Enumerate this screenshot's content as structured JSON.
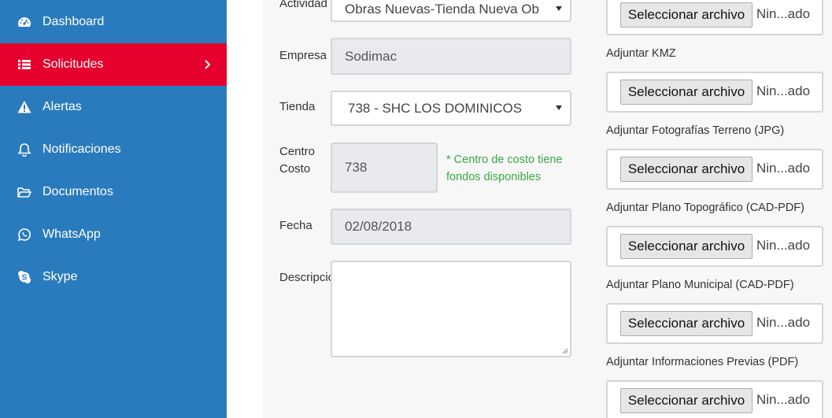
{
  "sidebar": {
    "items": [
      {
        "label": "Dashboard",
        "icon": "dashboard-icon"
      },
      {
        "label": "Solicitudes",
        "icon": "list-icon",
        "active": true
      },
      {
        "label": "Alertas",
        "icon": "warning-icon"
      },
      {
        "label": "Notificaciones",
        "icon": "bell-icon"
      },
      {
        "label": "Documentos",
        "icon": "folder-open-icon"
      },
      {
        "label": "WhatsApp",
        "icon": "whatsapp-icon"
      },
      {
        "label": "Skype",
        "icon": "skype-icon"
      }
    ],
    "colors": {
      "background": "#2a7bbd",
      "active": "#e6002d"
    }
  },
  "form": {
    "actividad": {
      "label": "Actividad",
      "value": "Obras Nuevas-Tienda Nueva Ob"
    },
    "empresa": {
      "label": "Empresa",
      "value": "Sodimac"
    },
    "tienda": {
      "label": "Tienda",
      "value": "738 - SHC LOS DOMINICOS"
    },
    "centro_costo": {
      "label_line1": "Centro",
      "label_line2": "Costo",
      "value": "738",
      "hint_line1": "* Centro de costo tiene",
      "hint_line2": "fondos disponibles"
    },
    "fecha": {
      "label": "Fecha",
      "value": "02/08/2018"
    },
    "descripcion": {
      "label": "Descripción",
      "value": ""
    }
  },
  "uploads": {
    "button_label": "Seleccionar archivo",
    "status": "Nin...ado",
    "items": [
      {
        "label": ""
      },
      {
        "label": "Adjuntar KMZ"
      },
      {
        "label": "Adjuntar Fotografías Terreno (JPG)"
      },
      {
        "label": "Adjuntar Plano Topográfico (CAD-PDF)"
      },
      {
        "label": "Adjuntar Plano Municipal (CAD-PDF)"
      },
      {
        "label": "Adjuntar Informaciones Previas (PDF)"
      }
    ]
  },
  "colors": {
    "hint": "#3aa845",
    "field_border": "#d3d6d9",
    "readonly_bg": "#e8eaed"
  }
}
